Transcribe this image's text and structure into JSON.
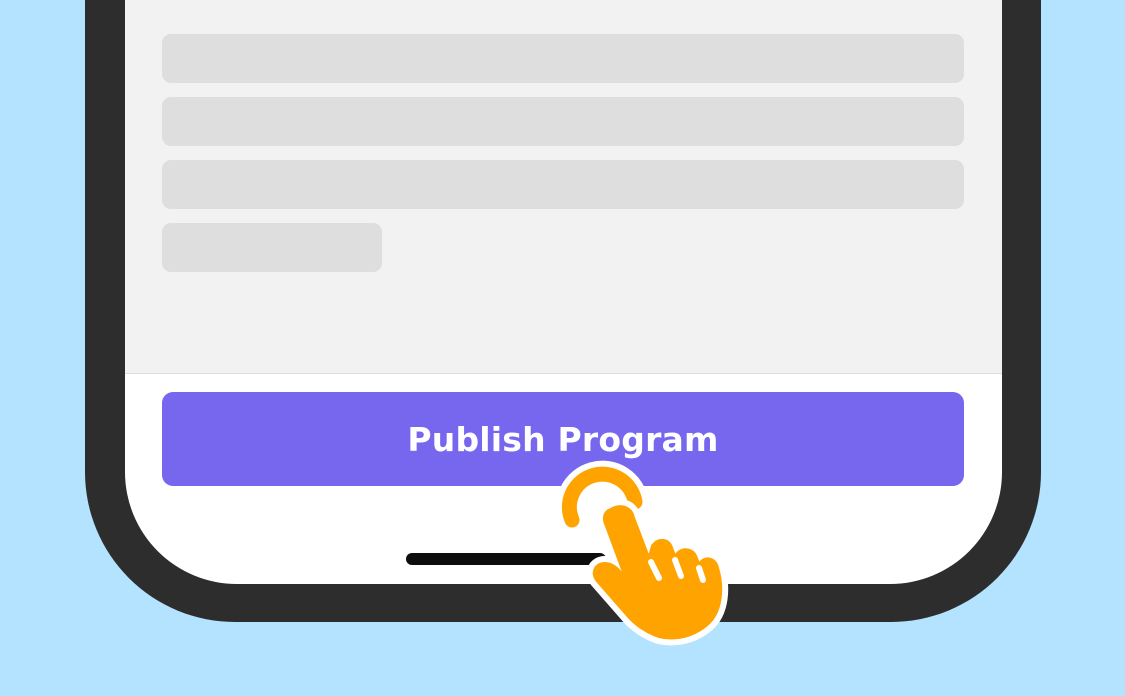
{
  "app": {
    "publish_button_label": "Publish Program"
  },
  "content": {
    "skeleton_lines": 4
  },
  "colors": {
    "background": "#b3e3fe",
    "phone_frame": "#2d2d2d",
    "content_bg": "#f2f2f2",
    "skeleton": "#dedede",
    "button": "#7667ee",
    "button_text": "#ffffff",
    "hand": "#ffa300"
  },
  "icons": {
    "pointer": "tap-hand-icon"
  }
}
